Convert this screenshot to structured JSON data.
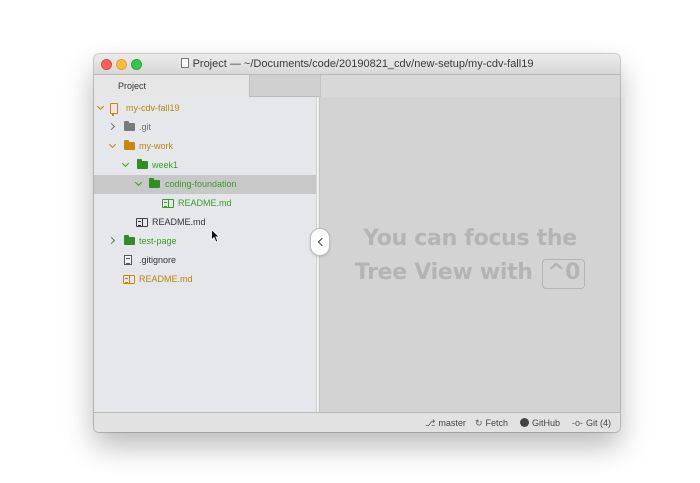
{
  "window": {
    "title": "Project — ~/Documents/code/20190821_cdv/new-setup/my-cdv-fall19"
  },
  "tabs": [
    {
      "label": "Project"
    }
  ],
  "tree": {
    "items": [
      {
        "label": "my-cdv-fall19",
        "icon": "repo-icon",
        "color": "#b8860b"
      },
      {
        "label": ".git",
        "icon": "folder-icon",
        "color": "#6f6f6f"
      },
      {
        "label": "my-work",
        "icon": "folder-icon",
        "color": "#b8860b"
      },
      {
        "label": "week1",
        "icon": "folder-icon",
        "color": "#3a9a2a"
      },
      {
        "label": "coding-foundation",
        "icon": "folder-icon",
        "color": "#3a9a2a"
      },
      {
        "label": "README.md",
        "icon": "book-icon",
        "color": "#3a9a2a"
      },
      {
        "label": "README.md",
        "icon": "book-icon",
        "color": "#333333"
      },
      {
        "label": "test-page",
        "icon": "folder-icon",
        "color": "#3a9a2a"
      },
      {
        "label": ".gitignore",
        "icon": "file-text-icon",
        "color": "#333333"
      },
      {
        "label": "README.md",
        "icon": "book-icon",
        "color": "#b8860b"
      }
    ]
  },
  "main": {
    "message_line1": "You can focus the",
    "message_line2": "Tree View with",
    "shortcut": "^0"
  },
  "statusbar": {
    "branch": "master",
    "fetch": "Fetch",
    "github": "GitHub",
    "git": "Git (4)"
  }
}
